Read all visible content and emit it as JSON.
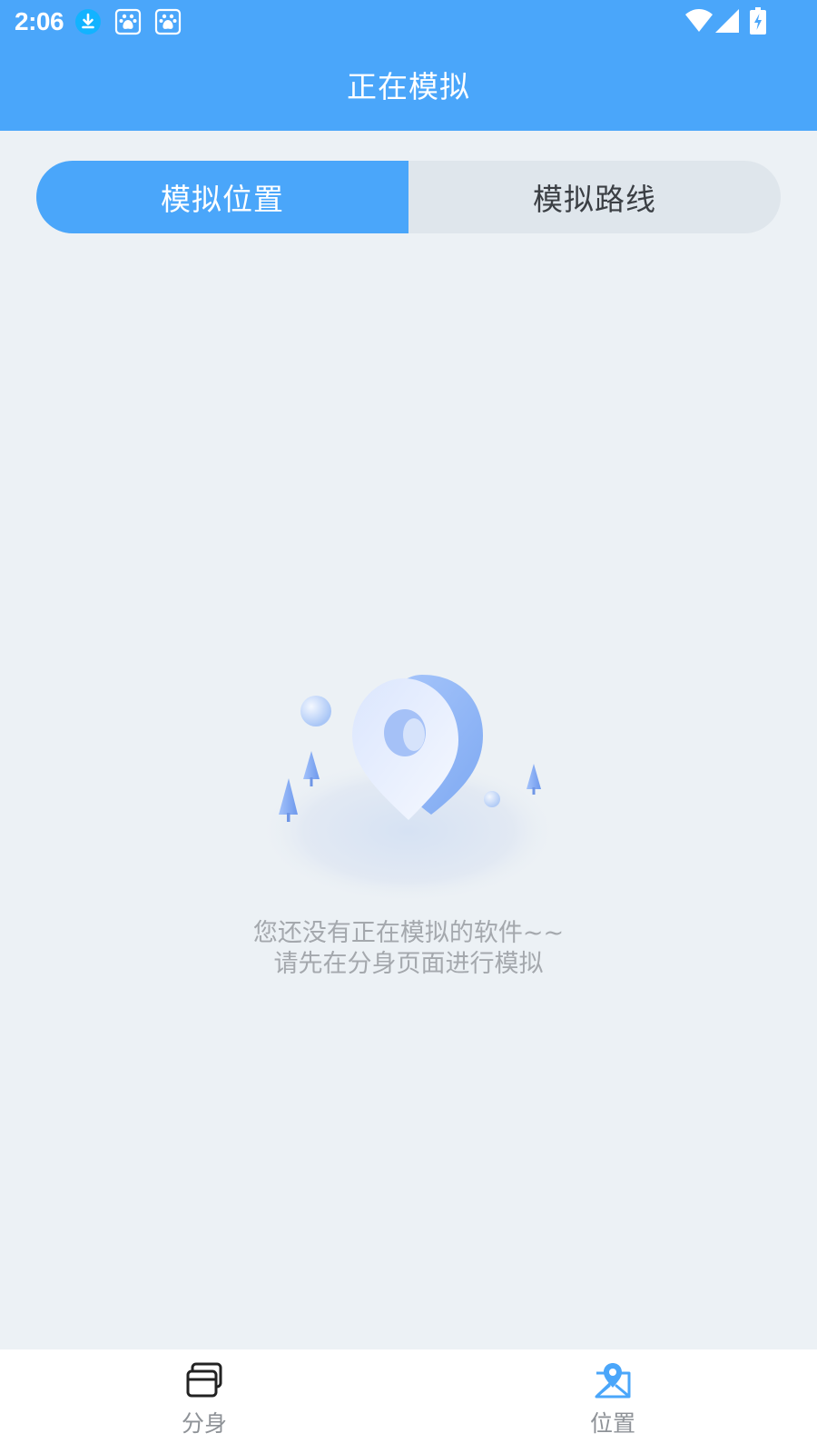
{
  "status_bar": {
    "time": "2:06",
    "icons": [
      "download-icon",
      "baidu-icon",
      "baidu-icon",
      "wifi-icon",
      "signal-icon",
      "battery-charging-icon"
    ]
  },
  "header": {
    "title": "正在模拟"
  },
  "tabs": [
    {
      "label": "模拟位置",
      "active": true
    },
    {
      "label": "模拟路线",
      "active": false
    }
  ],
  "empty_state": {
    "line1": "您还没有正在模拟的软件~~",
    "line2": "请先在分身页面进行模拟",
    "illustration": "location-pin-illustration"
  },
  "bottom_nav": {
    "items": [
      {
        "label": "分身",
        "icon": "cards-icon",
        "active": false
      },
      {
        "label": "位置",
        "icon": "map-pin-icon",
        "active": true
      }
    ]
  },
  "colors": {
    "primary": "#4aa6fa",
    "background": "#ecf1f5",
    "tab_inactive_bg": "#dfe6ec",
    "muted_text": "#a4a8ad"
  }
}
